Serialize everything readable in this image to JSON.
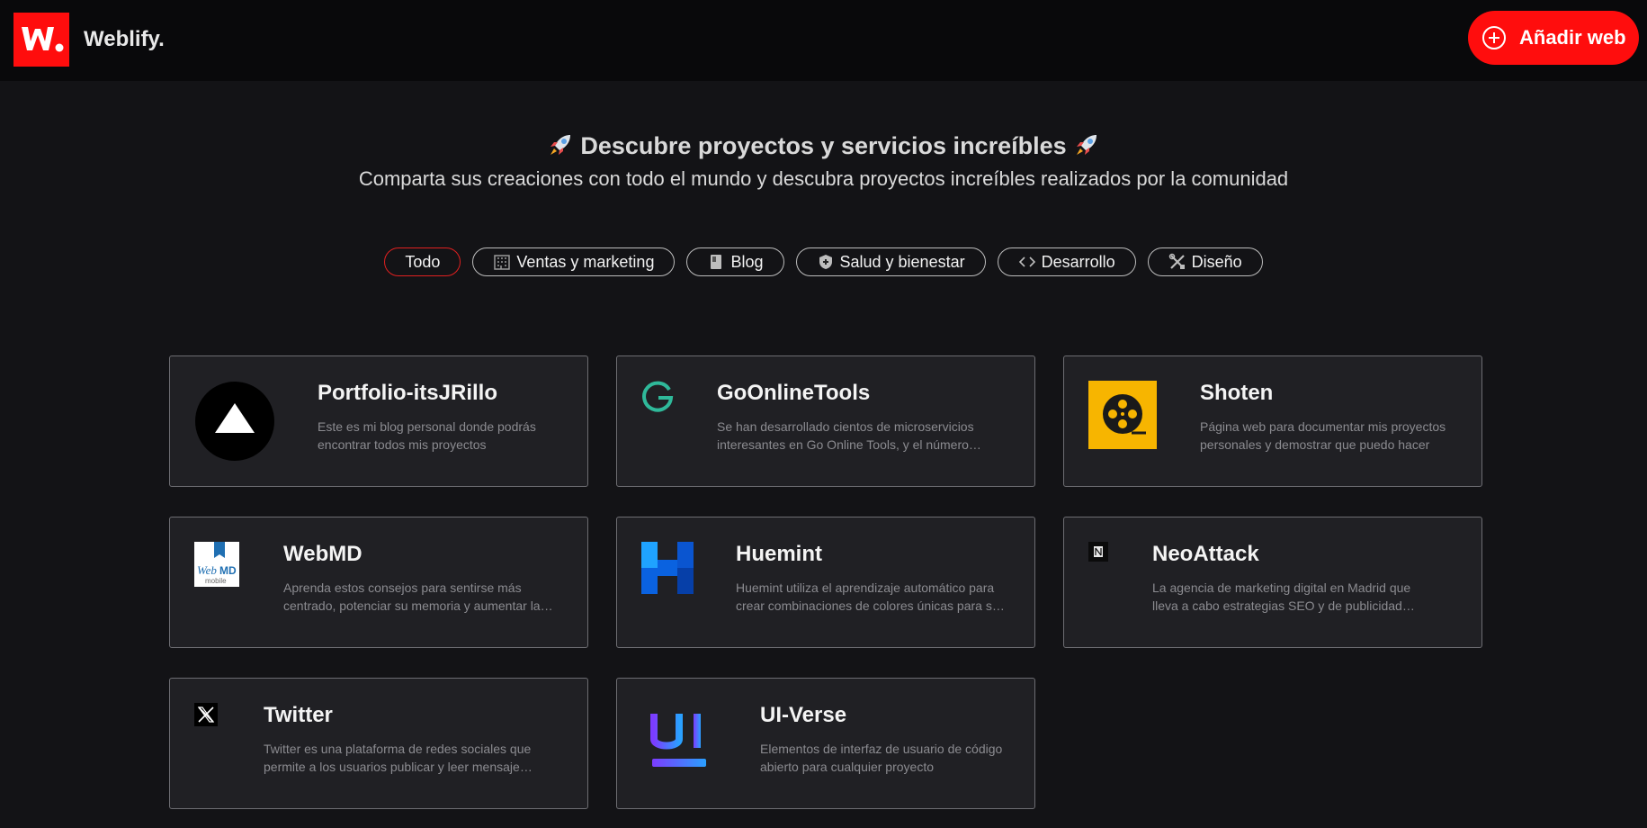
{
  "header": {
    "brand": "Weblify.",
    "logo_letter": "W",
    "add_button": "Añadir web",
    "accent": "#ff0d0d"
  },
  "hero": {
    "title": "Descubre proyectos y servicios increíbles",
    "subtitle": "Comparta sus creaciones con todo el mundo y descubra proyectos increíbles realizados por la comunidad"
  },
  "filters": [
    {
      "label": "Todo",
      "icon": "none",
      "active": true
    },
    {
      "label": "Ventas y marketing",
      "icon": "building-icon"
    },
    {
      "label": "Blog",
      "icon": "book-icon"
    },
    {
      "label": "Salud y bienestar",
      "icon": "shield-plus-icon"
    },
    {
      "label": "Desarrollo",
      "icon": "code-icon"
    },
    {
      "label": "Diseño",
      "icon": "tools-icon"
    }
  ],
  "cards": [
    {
      "title": "Portfolio-itsJRillo",
      "desc": "Este es mi blog personal donde podrás encontrar todos mis proyectos",
      "icon": "triangle-logo-icon"
    },
    {
      "title": "GoOnlineTools",
      "desc": "Se han desarrollado cientos de microservicios interesantes en Go Online Tools, y el número sigue creciendo",
      "icon": "goonlinetools-logo-icon"
    },
    {
      "title": "Shoten",
      "desc": "Página web para documentar mis proyectos personales y demostrar que puedo hacer",
      "icon": "film-reel-logo-icon"
    },
    {
      "title": "WebMD",
      "desc": "Aprenda estos consejos para sentirse más centrado, potenciar su memoria y aumentar la productividad",
      "icon": "webmd-logo-icon"
    },
    {
      "title": "Huemint",
      "desc": "Huemint utiliza el aprendizaje automático para crear combinaciones de colores únicas para su marca",
      "icon": "huemint-logo-icon"
    },
    {
      "title": "NeoAttack",
      "desc": "La agencia de marketing digital en Madrid que lleva a cabo estrategias SEO y de publicidad que atraen a la audiencia",
      "icon": "neoattack-logo-icon"
    },
    {
      "title": "Twitter",
      "desc": "Twitter es una plataforma de redes sociales que permite a los usuarios publicar y leer mensajes breves",
      "icon": "x-logo-icon"
    },
    {
      "title": "UI-Verse",
      "desc": "Elementos de interfaz de usuario de código abierto para cualquier proyecto",
      "icon": "uiverse-logo-icon"
    }
  ]
}
